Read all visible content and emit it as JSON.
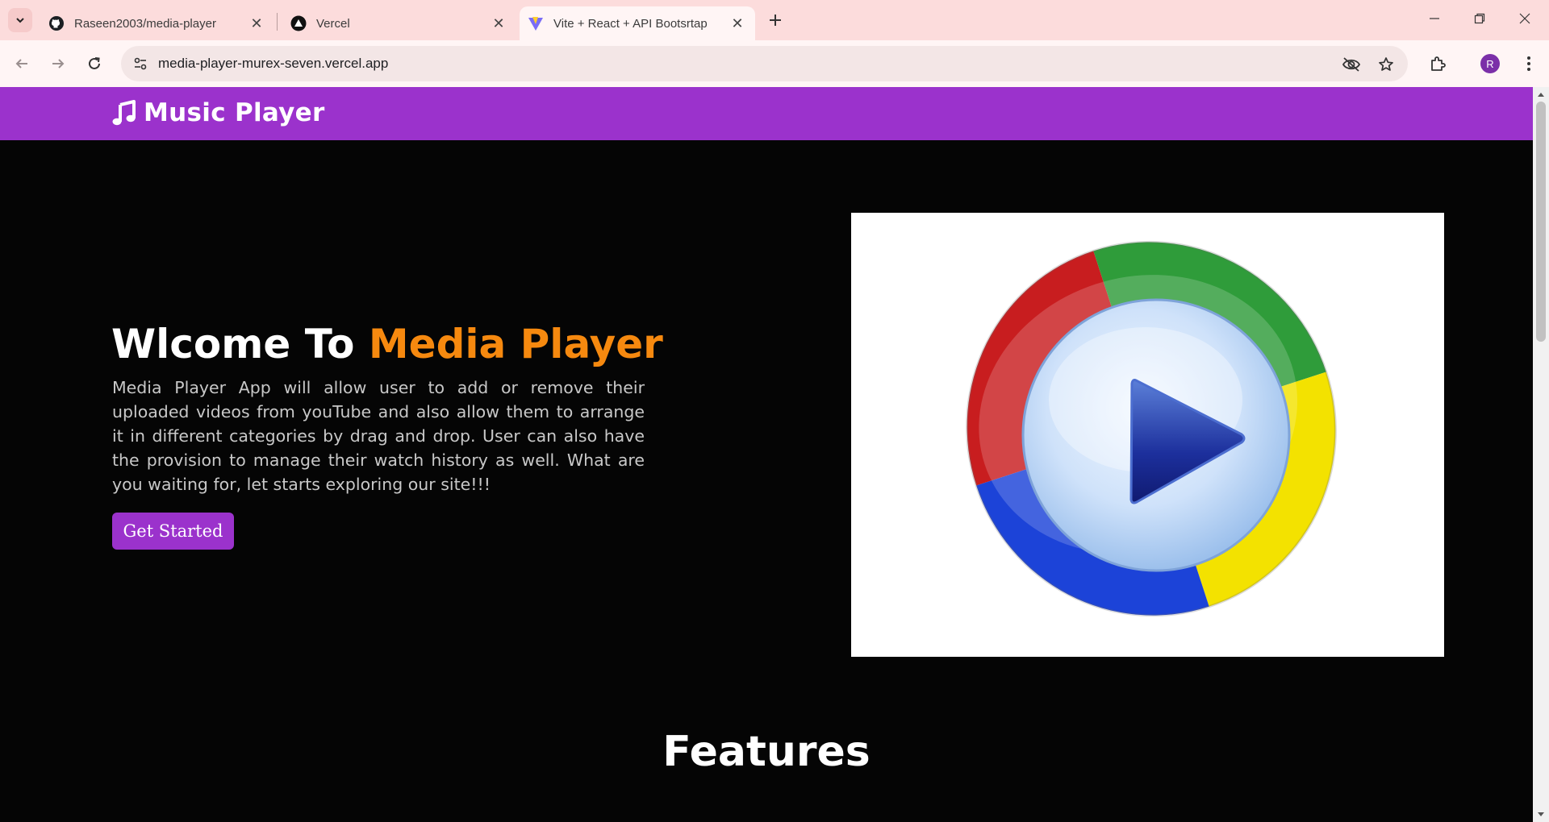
{
  "browser": {
    "tabs": [
      {
        "title": "Raseen2003/media-player",
        "icon": "github-icon",
        "active": false
      },
      {
        "title": "Vercel",
        "icon": "vercel-icon",
        "active": false
      },
      {
        "title": "Vite + React + API Bootsrtap",
        "icon": "vite-icon",
        "active": true
      }
    ],
    "address": "media-player-murex-seven.vercel.app",
    "profile_initial": "R",
    "colors": {
      "tabstrip": "#fcdcdc",
      "toolbar": "#fff5f5",
      "omnibox": "#f3e6e6",
      "avatar": "#7b2fa8"
    }
  },
  "page": {
    "brand": "Music Player",
    "hero": {
      "title_prefix": "Wlcome To ",
      "title_highlight": "Media Player",
      "description": "Media Player App will allow user to add or remove their uploaded videos from youTube and also allow them to arrange it in different categories by drag and drop. User can also have the provision to manage their watch history as well. What are you waiting for, let starts exploring our site!!!",
      "cta_label": "Get Started"
    },
    "features_heading": "Features",
    "colors": {
      "navbar": "#9b32cc",
      "background": "#050505",
      "highlight": "#f6890f",
      "button": "#9b32cc"
    }
  }
}
